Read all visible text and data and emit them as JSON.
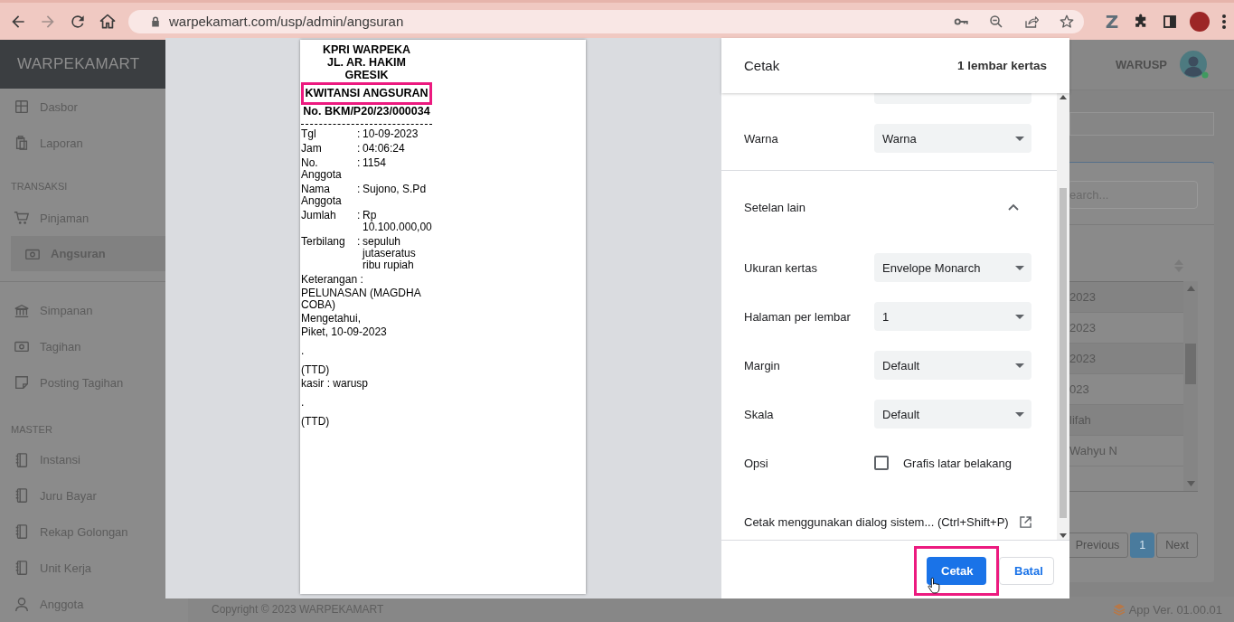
{
  "browser": {
    "url": "warpekamart.com/usp/admin/angsuran",
    "extension_label": "Z"
  },
  "app": {
    "brand": "WARPEKAMART",
    "user": "WARUSP",
    "user_online": true,
    "sidebar": [
      {
        "kind": "item",
        "label": "Dasbor",
        "selected": false
      },
      {
        "kind": "item",
        "label": "Laporan",
        "selected": false
      },
      {
        "kind": "section",
        "label": "TRANSAKSI"
      },
      {
        "kind": "item",
        "label": "Pinjaman",
        "selected": false
      },
      {
        "kind": "subitem",
        "label": "Angsuran",
        "selected": true
      },
      {
        "kind": "divider"
      },
      {
        "kind": "item",
        "label": "Simpanan",
        "selected": false
      },
      {
        "kind": "item",
        "label": "Tagihan",
        "selected": false
      },
      {
        "kind": "item",
        "label": "Posting Tagihan",
        "selected": false
      },
      {
        "kind": "section",
        "label": "MASTER"
      },
      {
        "kind": "item",
        "label": "Instansi",
        "selected": false
      },
      {
        "kind": "item",
        "label": "Juru Bayar",
        "selected": false
      },
      {
        "kind": "item",
        "label": "Rekap Golongan",
        "selected": false
      },
      {
        "kind": "item",
        "label": "Unit Kerja",
        "selected": false
      },
      {
        "kind": "item",
        "label": "Anggota",
        "selected": false
      }
    ],
    "table": {
      "search_placeholder": "earch...",
      "rows": [
        "2023",
        "2023",
        "2023",
        "023",
        "lifah",
        "Wahyu N"
      ]
    },
    "pagination": {
      "previous": "Previous",
      "pages": [
        {
          "label": "1",
          "selected": true
        }
      ],
      "next": "Next"
    },
    "footer": {
      "copyright": "Copyright © 2023 WARPEKAMART",
      "version": "App Ver. 01.00.01"
    }
  },
  "receipt": {
    "header": [
      "KPRI WARPEKA",
      "JL. AR. HAKIM",
      "GRESIK"
    ],
    "title": "KWITANSI ANGSURAN",
    "title_highlighted": true,
    "number": "No. BKM/P20/23/000034",
    "fields": [
      {
        "label": "Tgl",
        "separator": ":",
        "value": "10-09-2023"
      },
      {
        "label": "Jam",
        "separator": ":",
        "value": "04:06:24"
      },
      {
        "label": "No. Anggota",
        "separator": ":",
        "value": "1154"
      },
      {
        "label": "Nama Anggota",
        "separator": ":",
        "value": "Sujono, S.Pd"
      },
      {
        "label": "Jumlah",
        "separator": ":",
        "value": "Rp 10.100.000,00"
      },
      {
        "label": "Terbilang",
        "separator": ":",
        "value": "sepuluh jutaseratus ribu rupiah"
      }
    ],
    "lines": [
      {
        "kind": "text",
        "text": "Keterangan :"
      },
      {
        "kind": "text",
        "text": "PELUNASAN (MAGDHA COBA)"
      },
      {
        "kind": "text",
        "text": "Mengetahui,"
      },
      {
        "kind": "text",
        "text": "Piket, 10-09-2023"
      },
      {
        "kind": "spaced",
        "text": "."
      },
      {
        "kind": "spaced",
        "text": "(TTD)"
      },
      {
        "kind": "text",
        "text": "kasir : warusp"
      },
      {
        "kind": "spaced",
        "text": "."
      },
      {
        "kind": "spaced",
        "text": "(TTD)"
      }
    ]
  },
  "print_dialog": {
    "title": "Cetak",
    "sheets": "1 lembar kertas",
    "settings": [
      {
        "kind": "clipped_select"
      },
      {
        "kind": "select",
        "label": "Warna",
        "value": "Warna"
      },
      {
        "kind": "section",
        "label": "Setelan lain",
        "expanded": true
      },
      {
        "kind": "select",
        "label": "Ukuran kertas",
        "value": "Envelope Monarch"
      },
      {
        "kind": "select",
        "label": "Halaman per lembar",
        "value": "1"
      },
      {
        "kind": "select",
        "label": "Margin",
        "value": "Default"
      },
      {
        "kind": "select",
        "label": "Skala",
        "value": "Default"
      },
      {
        "kind": "checkbox",
        "label": "Opsi",
        "option": "Grafis latar belakang",
        "checked": false
      },
      {
        "kind": "link",
        "label": "Cetak menggunakan dialog sistem... (Ctrl+Shift+P)"
      }
    ],
    "buttons": [
      {
        "kind": "primary",
        "label": "Cetak",
        "highlighted": true
      },
      {
        "kind": "secondary",
        "label": "Batal",
        "highlighted": false
      }
    ]
  }
}
